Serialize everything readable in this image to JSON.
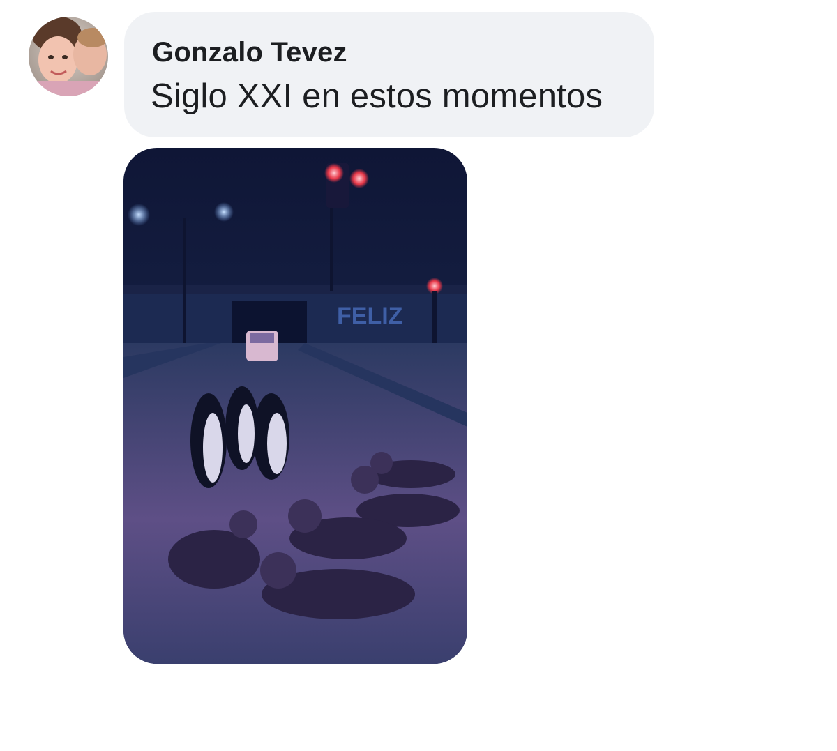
{
  "comment": {
    "author": "Gonzalo Tevez",
    "text": "Siglo XXI en estos momentos",
    "avatar_icon": "profile-photo",
    "attachment": {
      "icon": "photo-attachment",
      "sign_text": "FELIZ",
      "colors": {
        "sky": "#121a3a",
        "snow": "#5e4f86",
        "light": "#7fb4ff",
        "signal": "#ff3b4a"
      }
    }
  },
  "colors": {
    "bubble": "#f0f2f5",
    "text": "#1c1e21",
    "background": "#ffffff"
  }
}
